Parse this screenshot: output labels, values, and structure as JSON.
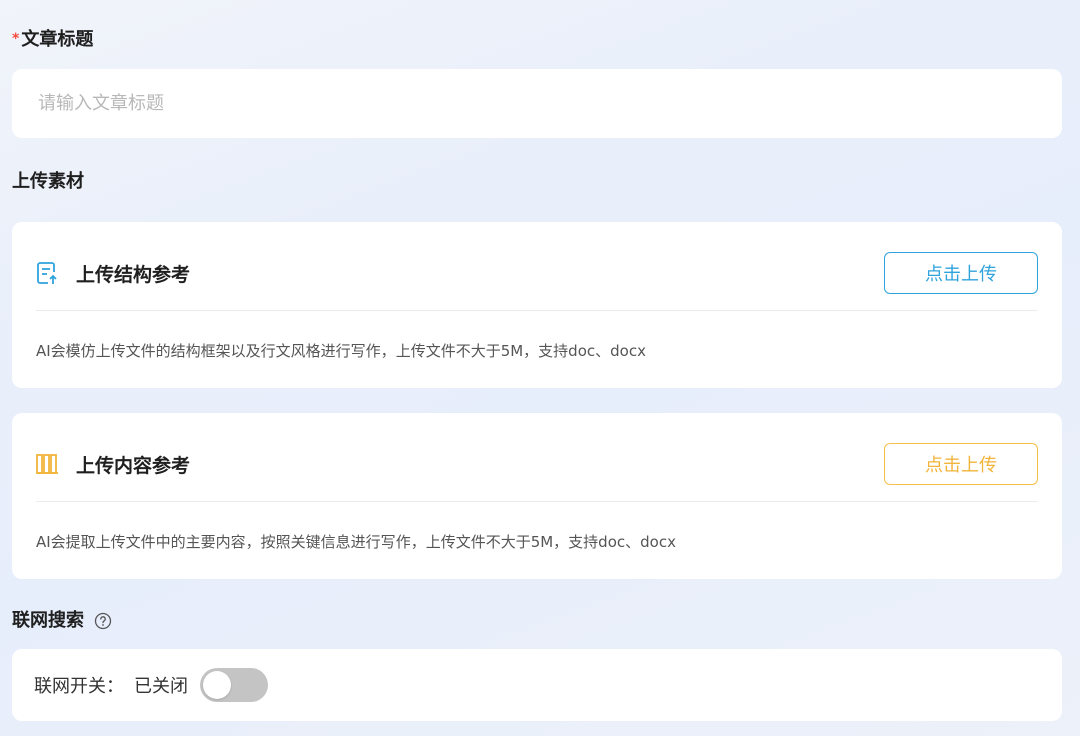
{
  "title_field": {
    "required_marker": "*",
    "label": "文章标题",
    "placeholder": "请输入文章标题",
    "value": ""
  },
  "upload_section": {
    "label": "上传素材",
    "cards": [
      {
        "icon": "document-upload-icon",
        "title": "上传结构参考",
        "button_label": "点击上传",
        "description": "AI会模仿上传文件的结构框架以及行文风格进行写作，上传文件不大于5M，支持doc、docx",
        "accent_color": "#2fa3dc"
      },
      {
        "icon": "books-icon",
        "title": "上传内容参考",
        "button_label": "点击上传",
        "description": "AI会提取上传文件中的主要内容，按照关键信息进行写作，上传文件不大于5M，支持doc、docx",
        "accent_color": "#f2b43a"
      }
    ]
  },
  "web_search": {
    "label": "联网搜索",
    "help_icon": "help-circle-icon",
    "switch_label": "联网开关：",
    "status": "已关闭",
    "enabled": false
  }
}
